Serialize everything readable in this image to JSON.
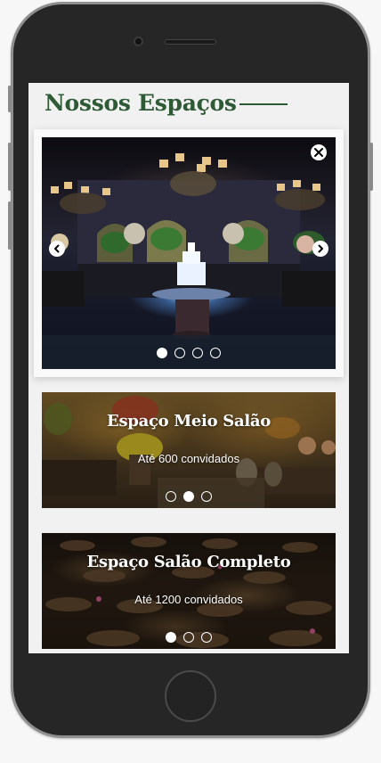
{
  "page": {
    "title": "Nossos Espaços"
  },
  "featured": {
    "icon_close": "close-icon",
    "icon_prev": "chevron-left-icon",
    "icon_next": "chevron-right-icon",
    "slide_count": 4,
    "active_slide": 1
  },
  "spaces": [
    {
      "name": "Espaço Meio Salão",
      "capacity": "Até 600 convidados",
      "slide_count": 3,
      "active_slide": 2
    },
    {
      "name": "Espaço Salão Completo",
      "capacity": "Até 1200 convidados",
      "slide_count": 3,
      "active_slide": 1
    }
  ],
  "colors": {
    "title_green": "#2f5a36",
    "screen_bg": "#f1f1f1",
    "phone_body": "#262626"
  }
}
